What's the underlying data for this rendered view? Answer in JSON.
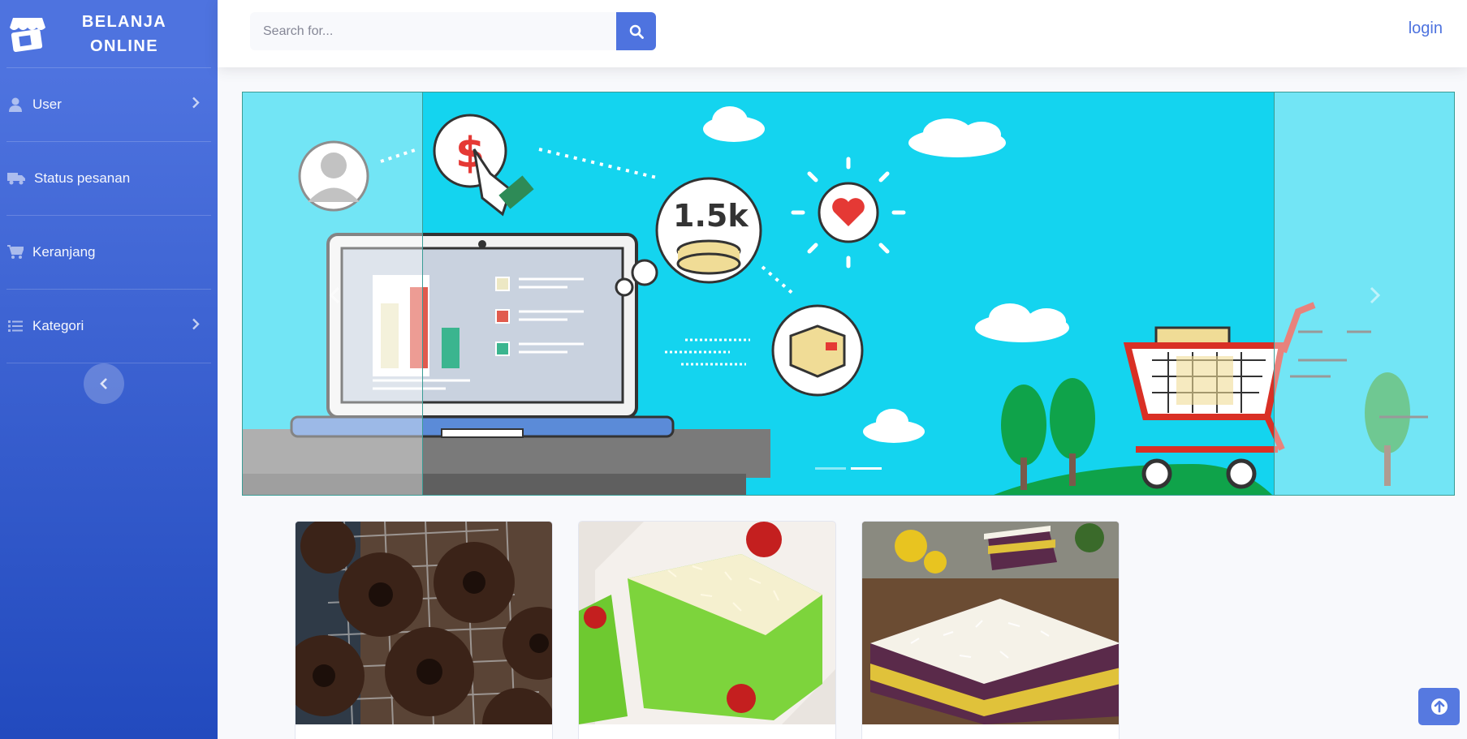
{
  "brand": {
    "line1": "BELANJA",
    "line2": "ONLINE"
  },
  "sidebar": {
    "items": [
      {
        "label": "User",
        "icon": "user-icon",
        "has_submenu": true
      },
      {
        "label": "Status pesanan",
        "icon": "truck-icon",
        "has_submenu": false
      },
      {
        "label": "Keranjang",
        "icon": "cart-icon",
        "has_submenu": false
      },
      {
        "label": "Kategori",
        "icon": "list-icon",
        "has_submenu": true
      }
    ]
  },
  "topbar": {
    "search_placeholder": "Search for...",
    "login_label": "login"
  },
  "carousel": {
    "banner_text": "1.5k",
    "slides": 2,
    "active_slide": 2
  },
  "products": [
    {
      "image": "chocolate-donuts"
    },
    {
      "image": "green-pandan-cake"
    },
    {
      "image": "purple-layer-cake"
    }
  ],
  "colors": {
    "primary": "#4e73df",
    "banner_bg": "#14d4ef"
  }
}
